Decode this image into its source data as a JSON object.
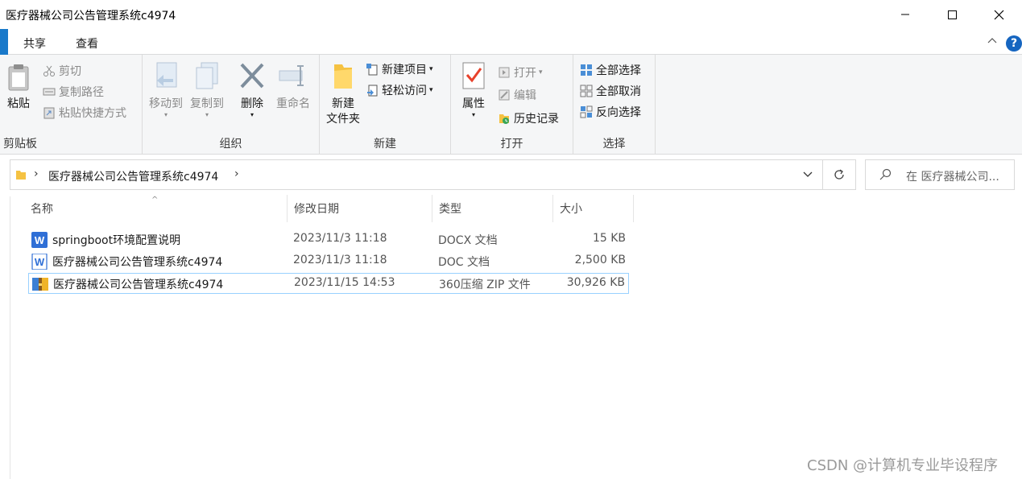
{
  "window": {
    "title": "医疗器械公司公告管理系统c4974"
  },
  "tabs": {
    "share": "共享",
    "view": "查看"
  },
  "ribbon": {
    "clipboard": {
      "paste": "粘贴",
      "cut": "剪切",
      "copy_path": "复制路径",
      "paste_shortcut": "粘贴快捷方式",
      "title": "剪贴板"
    },
    "organize": {
      "move_to": "移动到",
      "copy_to": "复制到",
      "delete": "删除",
      "rename": "重命名",
      "title": "组织"
    },
    "new": {
      "new_folder_line1": "新建",
      "new_folder_line2": "文件夹",
      "new_item": "新建项目",
      "easy_access": "轻松访问",
      "title": "新建"
    },
    "open": {
      "properties": "属性",
      "open": "打开",
      "edit": "编辑",
      "history": "历史记录",
      "title": "打开"
    },
    "select": {
      "select_all": "全部选择",
      "select_none": "全部取消",
      "invert": "反向选择",
      "title": "选择"
    }
  },
  "address": {
    "path": "医疗器械公司公告管理系统c4974"
  },
  "search": {
    "placeholder": "在 医疗器械公司..."
  },
  "columns": {
    "name": "名称",
    "date": "修改日期",
    "type": "类型",
    "size": "大小"
  },
  "files": [
    {
      "name": "springboot环境配置说明",
      "date": "2023/11/3 11:18",
      "type": "DOCX 文档",
      "size": "15 KB",
      "icon": "word-docx-icon"
    },
    {
      "name": "医疗器械公司公告管理系统c4974",
      "date": "2023/11/3 11:18",
      "type": "DOC 文档",
      "size": "2,500 KB",
      "icon": "word-doc-icon"
    },
    {
      "name": "医疗器械公司公告管理系统c4974",
      "date": "2023/11/15 14:53",
      "type": "360压缩 ZIP 文件",
      "size": "30,926 KB",
      "icon": "zip-archive-icon"
    }
  ],
  "watermark": "CSDN @计算机专业毕设程序",
  "colors": {
    "accent": "#1979ca",
    "selection_border": "#99d1ff",
    "help": "#1565c0"
  }
}
